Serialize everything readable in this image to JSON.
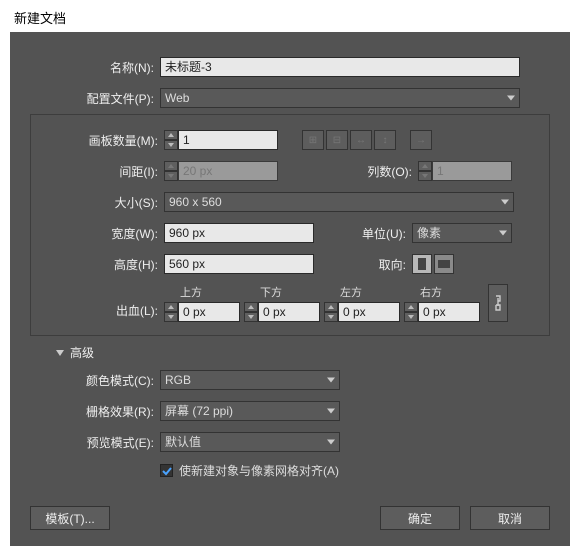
{
  "title": "新建文档",
  "labels": {
    "name": "名称(N):",
    "profile": "配置文件(P):",
    "artboards": "画板数量(M):",
    "spacing": "间距(I):",
    "columns": "列数(O):",
    "size": "大小(S):",
    "width": "宽度(W):",
    "height": "高度(H):",
    "units": "单位(U):",
    "orientation": "取向:",
    "bleed": "出血(L):",
    "bleed_top": "上方",
    "bleed_bottom": "下方",
    "bleed_left": "左方",
    "bleed_right": "右方",
    "advanced": "高级",
    "color_mode": "颜色模式(C):",
    "raster_effects": "栅格效果(R):",
    "preview_mode": "预览模式(E):",
    "align_pixel": "使新建对象与像素网格对齐(A)"
  },
  "values": {
    "name": "未标题-3",
    "profile": "Web",
    "artboards": "1",
    "spacing": "20 px",
    "columns": "1",
    "size": "960 x 560",
    "width": "960 px",
    "height": "560 px",
    "units": "像素",
    "bleed_top": "0 px",
    "bleed_bottom": "0 px",
    "bleed_left": "0 px",
    "bleed_right": "0 px",
    "color_mode": "RGB",
    "raster_effects": "屏幕 (72 ppi)",
    "preview_mode": "默认值"
  },
  "buttons": {
    "templates": "模板(T)...",
    "ok": "确定",
    "cancel": "取消"
  }
}
